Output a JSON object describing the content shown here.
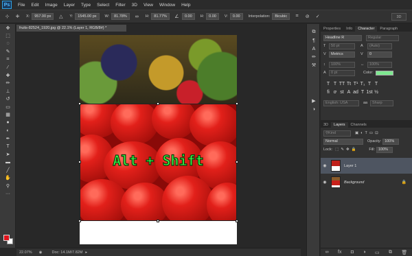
{
  "menu": {
    "logo": "Ps",
    "items": [
      "File",
      "Edit",
      "Image",
      "Layer",
      "Type",
      "Select",
      "Filter",
      "3D",
      "View",
      "Window",
      "Help"
    ]
  },
  "options": {
    "x_label": "X:",
    "x_value": "957.00 px",
    "y_label": "Y:",
    "y_value": "1545.00 px",
    "w_label": "W:",
    "w_value": "81.78%",
    "h_label": "H:",
    "h_value": "81.77%",
    "angle_value": "0.00",
    "hskew_label": "H:",
    "hskew_value": "0.00",
    "vskew_label": "V:",
    "vskew_value": "0.00",
    "interp_label": "Interpolation:",
    "interp_value": "Bicubic",
    "mode_3d": "3D"
  },
  "document": {
    "tab_title": "fruits-82524_1920.jpg @ 22.1% (Layer 1, RGB/8#) *",
    "overlay_text": "Alt + Shift"
  },
  "status": {
    "zoom": "22.07%",
    "doc_info": "Doc: 14.1M/7.82M"
  },
  "character_panel": {
    "tabs": [
      "Properties",
      "Info",
      "Character",
      "Paragraph"
    ],
    "active_tab": "Character",
    "font_family": "Headline R",
    "font_style": "Regular",
    "font_size": "50 pt",
    "leading": "(Auto)",
    "kerning": "Metrics",
    "tracking": "0",
    "vscale": "100%",
    "hscale": "100%",
    "baseline": "0 pt",
    "color_label": "Color:",
    "color_hex": "#7ee890",
    "language": "English: USA",
    "antialias": "Sharp"
  },
  "layers_panel": {
    "tabs": [
      "3D",
      "Layers",
      "Channels"
    ],
    "active_tab": "Layers",
    "filter": "Kind",
    "blend_mode": "Normal",
    "opacity_label": "Opacity:",
    "opacity": "100%",
    "lock_label": "Lock:",
    "fill_label": "Fill:",
    "fill": "100%",
    "layers": [
      {
        "name": "Layer 1",
        "selected": true
      },
      {
        "name": "Background",
        "selected": false
      }
    ]
  },
  "colors": {
    "foreground": "#e0141c",
    "background": "#ffffff",
    "text_color": "#3cff4a"
  }
}
